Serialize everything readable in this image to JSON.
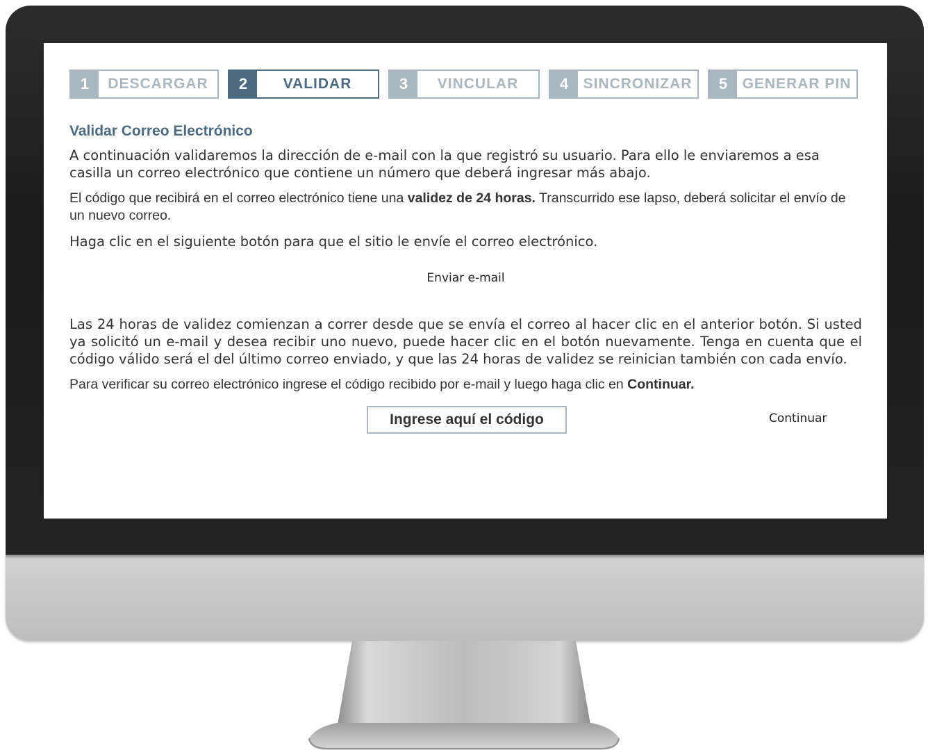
{
  "steps": [
    {
      "num": "1",
      "label": "DESCARGAR",
      "active": false
    },
    {
      "num": "2",
      "label": "VALIDAR",
      "active": true
    },
    {
      "num": "3",
      "label": "VINCULAR",
      "active": false
    },
    {
      "num": "4",
      "label": "SINCRONIZAR",
      "active": false
    },
    {
      "num": "5",
      "label": "GENERAR PIN",
      "active": false
    }
  ],
  "page": {
    "title": "Validar Correo Electrónico",
    "intro": "A continuación validaremos la dirección de e-mail con la que registró su usuario. Para ello le enviaremos a esa casilla un correo electrónico que contiene un número que deberá ingresar más abajo.",
    "validity_before": "El código que recibirá en el correo electrónico tiene una ",
    "validity_bold": "validez de 24 horas.",
    "validity_after": " Transcurrido ese lapso, deberá solicitar el envío de un nuevo correo.",
    "click_instruction": "Haga clic en el siguiente botón para que el sitio le envíe el correo electrónico.",
    "send_button": "Enviar e-mail",
    "validity_note": "Las 24 horas de validez comienzan a correr desde que se envía el correo al hacer clic en el anterior botón. Si usted ya solicitó un e-mail y desea recibir uno nuevo, puede hacer clic en el botón nuevamente. Tenga en cuenta que el código válido será el del último correo enviado, y que las 24 horas de validez se reinician también con cada envío.",
    "verify_before": "Para verificar su correo electrónico ingrese el código recibido por e-mail y luego haga clic en ",
    "verify_bold": "Continuar.",
    "code_placeholder": "Ingrese aquí el código",
    "continue_button": "Continuar"
  },
  "colors": {
    "accent": "#4d6b80",
    "inactive": "#a9b7c0",
    "bezel": "#1f1f1f",
    "chin": "#c8c8c8"
  }
}
